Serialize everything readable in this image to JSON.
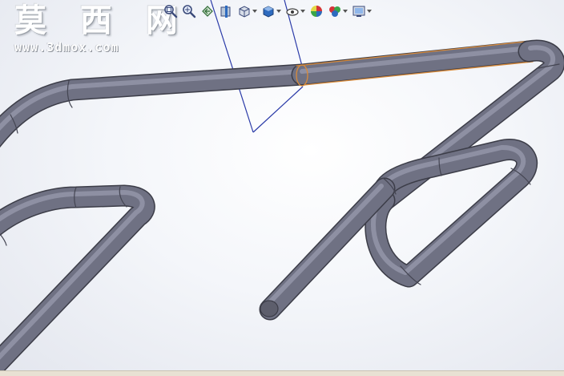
{
  "watermark": {
    "chinese": "莫 西 网",
    "url": "www.3dmox.com"
  },
  "toolbar": {
    "items": [
      {
        "icon": "zoom-to-fit-icon"
      },
      {
        "icon": "zoom-to-area-icon"
      },
      {
        "icon": "previous-view-icon"
      },
      {
        "icon": "section-view-icon"
      },
      {
        "icon": "view-orientation-icon",
        "dropdown": true
      },
      {
        "icon": "display-style-icon",
        "dropdown": true
      },
      {
        "icon": "hide-show-items-icon",
        "dropdown": true
      },
      {
        "icon": "edit-appearance-icon"
      },
      {
        "icon": "apply-scene-icon",
        "dropdown": true
      },
      {
        "icon": "view-settings-icon",
        "dropdown": true
      }
    ]
  },
  "colors": {
    "tube": "#6f7183",
    "selection": "#d98b3a",
    "plane": "#2a3aa8"
  }
}
